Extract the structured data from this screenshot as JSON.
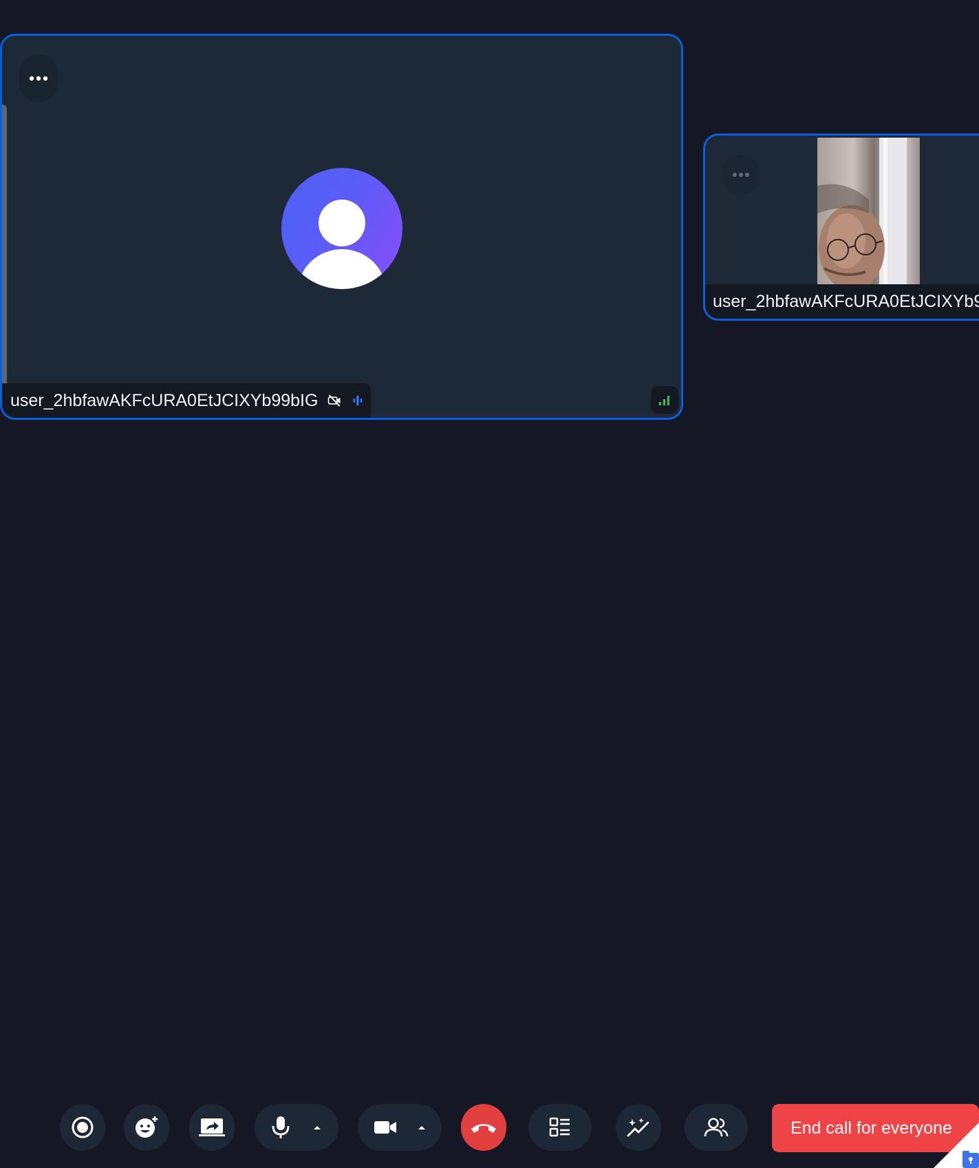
{
  "participants": {
    "main": {
      "name": "user_2hbfawAKFcURA0EtJCIXYb99bIG",
      "camera": "off",
      "icons": [
        "more-icon",
        "avatar-icon",
        "video-off-icon",
        "speaking-icon",
        "signal-icon"
      ]
    },
    "side": {
      "name": "user_2hbfawAKFcURA0EtJCIXYb9",
      "camera": "on",
      "icons": [
        "more-icon"
      ]
    }
  },
  "controls": {
    "buttons": [
      "record-icon",
      "reaction-icon",
      "screen-share-icon",
      "microphone-icon",
      "camera-icon",
      "hang-up-icon",
      "layout-icon",
      "effects-icon",
      "participants-icon"
    ],
    "end_all_label": "End call for everyone"
  },
  "colors": {
    "background": "#151824",
    "tile": "#1e2938",
    "tile_border": "#0c5ee0",
    "hangup": "#e2403f",
    "end_all": "#ee4447",
    "signal": "#22c55e"
  }
}
